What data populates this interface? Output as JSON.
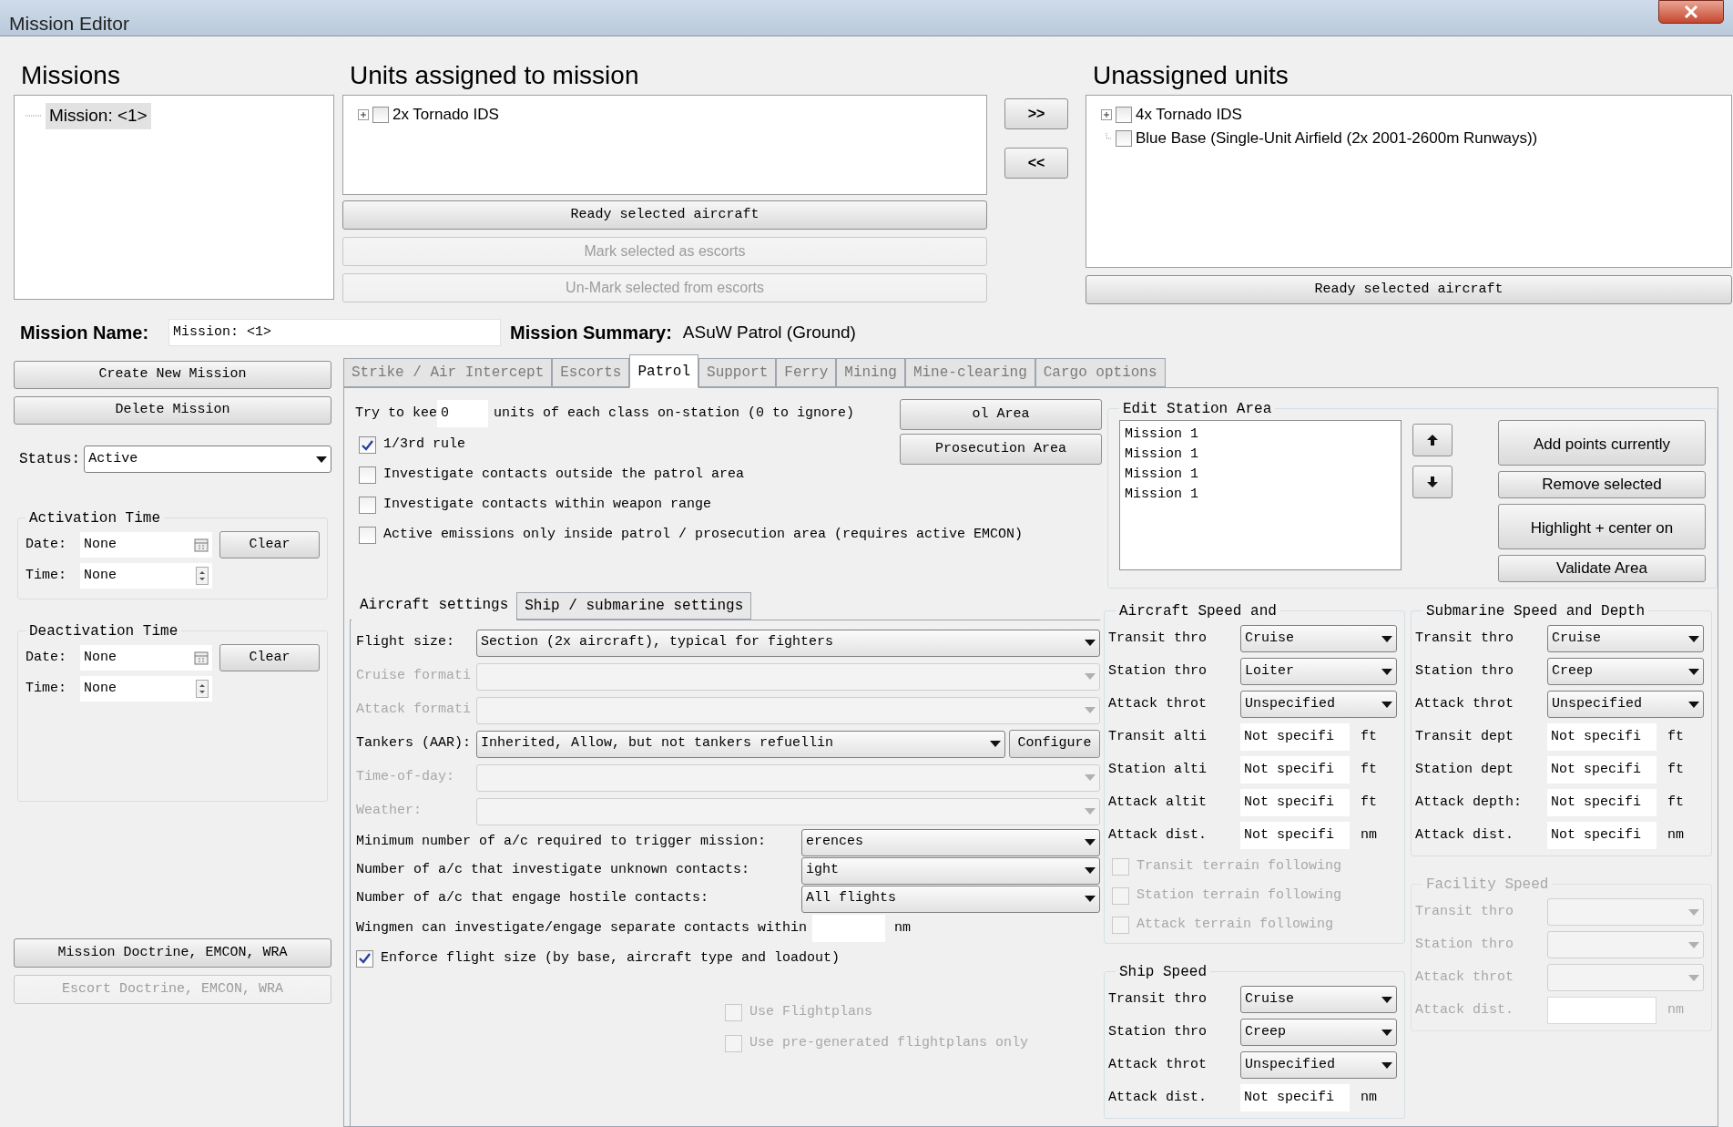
{
  "window": {
    "title": "Mission Editor"
  },
  "missions": {
    "heading": "Missions",
    "items": [
      {
        "label": "Mission: <1>",
        "selected": true
      }
    ]
  },
  "assigned": {
    "heading": "Units assigned to mission",
    "items": [
      {
        "label": "2x Tornado IDS",
        "checked": false,
        "expandable": true
      }
    ],
    "buttons": [
      {
        "label": "Ready selected aircraft",
        "disabled": false
      },
      {
        "label": "Mark selected as escorts",
        "disabled": true
      },
      {
        "label": "Un-Mark selected from escorts",
        "disabled": true
      }
    ]
  },
  "transfer_buttons": [
    ">>",
    "<<"
  ],
  "unassigned": {
    "heading": "Unassigned units",
    "items": [
      {
        "label": "4x Tornado IDS",
        "checked": false,
        "expandable": true
      },
      {
        "label": "Blue Base (Single-Unit Airfield (2x 2001-2600m Runways))",
        "checked": false,
        "expandable": false
      }
    ],
    "button": "Ready selected aircraft"
  },
  "mission_name": {
    "label": "Mission Name:",
    "value": "Mission: <1>"
  },
  "mission_summary": {
    "label": "Mission Summary:",
    "value": "ASuW Patrol (Ground)"
  },
  "mission_buttons": [
    "Create New Mission",
    "Delete Mission"
  ],
  "status": {
    "label": "Status:",
    "value": "Active"
  },
  "time_groups": [
    {
      "title": "Activation Time",
      "date_label": "Date:",
      "date": "None",
      "clear": "Clear",
      "time_label": "Time:",
      "time": "None"
    },
    {
      "title": "Deactivation Time",
      "date_label": "Date:",
      "date": "None",
      "clear": "Clear",
      "time_label": "Time:",
      "time": "None"
    }
  ],
  "doctrine_buttons": [
    {
      "label": "Mission Doctrine, EMCON, WRA",
      "disabled": false
    },
    {
      "label": "Escort Doctrine, EMCON, WRA",
      "disabled": true
    }
  ],
  "tabs": [
    {
      "label": "Strike / Air Intercept",
      "selected": false
    },
    {
      "label": "Escorts",
      "selected": false
    },
    {
      "label": "Patrol",
      "selected": true
    },
    {
      "label": "Support",
      "selected": false
    },
    {
      "label": "Ferry",
      "selected": false
    },
    {
      "label": "Mining",
      "selected": false
    },
    {
      "label": "Mine-clearing",
      "selected": false
    },
    {
      "label": "Cargo options",
      "selected": false
    }
  ],
  "patrol": {
    "keep": {
      "prefix": "Try to kee",
      "value": "0",
      "suffix": "units of each class on-station (0 to ignore)"
    },
    "options": [
      {
        "label": "1/3rd rule",
        "checked": true
      },
      {
        "label": "Investigate contacts outside the patrol area",
        "checked": false
      },
      {
        "label": "Investigate contacts within weapon range",
        "checked": false
      },
      {
        "label": "Active emissions only inside patrol / prosecution area (requires active EMCON)",
        "checked": false
      }
    ],
    "area_buttons": [
      "ol Area",
      "Prosecution Area"
    ],
    "station_area": {
      "title": "Edit Station Area",
      "points": [
        "Mission 1",
        "Mission 1",
        "Mission 1",
        "Mission 1"
      ],
      "buttons": [
        "Add points currently",
        "Remove selected",
        "Highlight + center on",
        "Validate Area"
      ]
    },
    "subtabs": [
      {
        "label": "Aircraft settings",
        "selected": true
      },
      {
        "label": "Ship / submarine settings",
        "selected": false
      }
    ],
    "fields": [
      {
        "label": "Flight size:",
        "value": "Section (2x aircraft), typical for fighters",
        "disabled": false
      },
      {
        "label": "Cruise formati",
        "disabled": true
      },
      {
        "label": "Attack formati",
        "disabled": true
      },
      {
        "label": "Tankers (AAR):",
        "value": "Inherited, Allow, but not tankers refuellin",
        "disabled": false,
        "button": "Configure"
      },
      {
        "label": "Time-of-day:",
        "disabled": true
      },
      {
        "label": "Weather:",
        "disabled": true
      }
    ],
    "trigger_fields": [
      {
        "label": "Minimum number of a/c required to trigger mission:",
        "value": "erences"
      },
      {
        "label": "Number of a/c that investigate unknown contacts:",
        "value": "ight"
      },
      {
        "label": "Number of a/c that engage hostile contacts:",
        "value": "All flights"
      }
    ],
    "wingmen": {
      "label": "Wingmen can investigate/engage separate contacts within",
      "unit": "nm"
    },
    "enforce": {
      "label": "Enforce flight size (by base, aircraft type and loadout)",
      "checked": true
    },
    "flightplans": [
      {
        "label": "Use Flightplans",
        "checked": false,
        "disabled": true
      },
      {
        "label": "Use pre-generated flightplans only",
        "checked": false,
        "disabled": true
      }
    ],
    "speed_columns": [
      [
        {
          "title": "Aircraft Speed and",
          "disabled": false,
          "throttles": [
            {
              "label": "Transit thro",
              "value": "Cruise"
            },
            {
              "label": "Station thro",
              "value": "Loiter"
            },
            {
              "label": "Attack throt",
              "value": "Unspecified"
            }
          ],
          "values": [
            {
              "label": "Transit alti",
              "value": "Not specifi",
              "unit": "ft"
            },
            {
              "label": "Station alti",
              "value": "Not specifi",
              "unit": "ft"
            },
            {
              "label": "Attack altit",
              "value": "Not specifi",
              "unit": "ft"
            },
            {
              "label": "Attack dist.",
              "value": "Not specifi",
              "unit": "nm"
            }
          ],
          "terrain": [
            {
              "label": "Transit terrain following",
              "checked": false,
              "disabled": true
            },
            {
              "label": "Station terrain following",
              "checked": false,
              "disabled": true
            },
            {
              "label": "Attack terrain following",
              "checked": false,
              "disabled": true
            }
          ]
        },
        {
          "title": "Ship Speed",
          "disabled": false,
          "throttles": [
            {
              "label": "Transit thro",
              "value": "Cruise"
            },
            {
              "label": "Station thro",
              "value": "Creep"
            },
            {
              "label": "Attack throt",
              "value": "Unspecified"
            }
          ],
          "values": [
            {
              "label": "Attack dist.",
              "value": "Not specifi",
              "unit": "nm"
            }
          ]
        }
      ],
      [
        {
          "title": "Submarine Speed and Depth",
          "disabled": false,
          "throttles": [
            {
              "label": "Transit thro",
              "value": "Cruise"
            },
            {
              "label": "Station thro",
              "value": "Creep"
            },
            {
              "label": "Attack throt",
              "value": "Unspecified"
            }
          ],
          "values": [
            {
              "label": "Transit dept",
              "value": "Not specifi",
              "unit": "ft"
            },
            {
              "label": "Station dept",
              "value": "Not specifi",
              "unit": "ft"
            },
            {
              "label": "Attack depth:",
              "value": "Not specifi",
              "unit": "ft"
            },
            {
              "label": "Attack dist.",
              "value": "Not specifi",
              "unit": "nm"
            }
          ]
        },
        {
          "title": "Facility Speed",
          "disabled": true,
          "throttles": [
            {
              "label": "Transit thro"
            },
            {
              "label": "Station thro"
            },
            {
              "label": "Attack throt"
            }
          ],
          "values": [
            {
              "label": "Attack dist.",
              "unit": "nm"
            }
          ]
        }
      ]
    ]
  }
}
